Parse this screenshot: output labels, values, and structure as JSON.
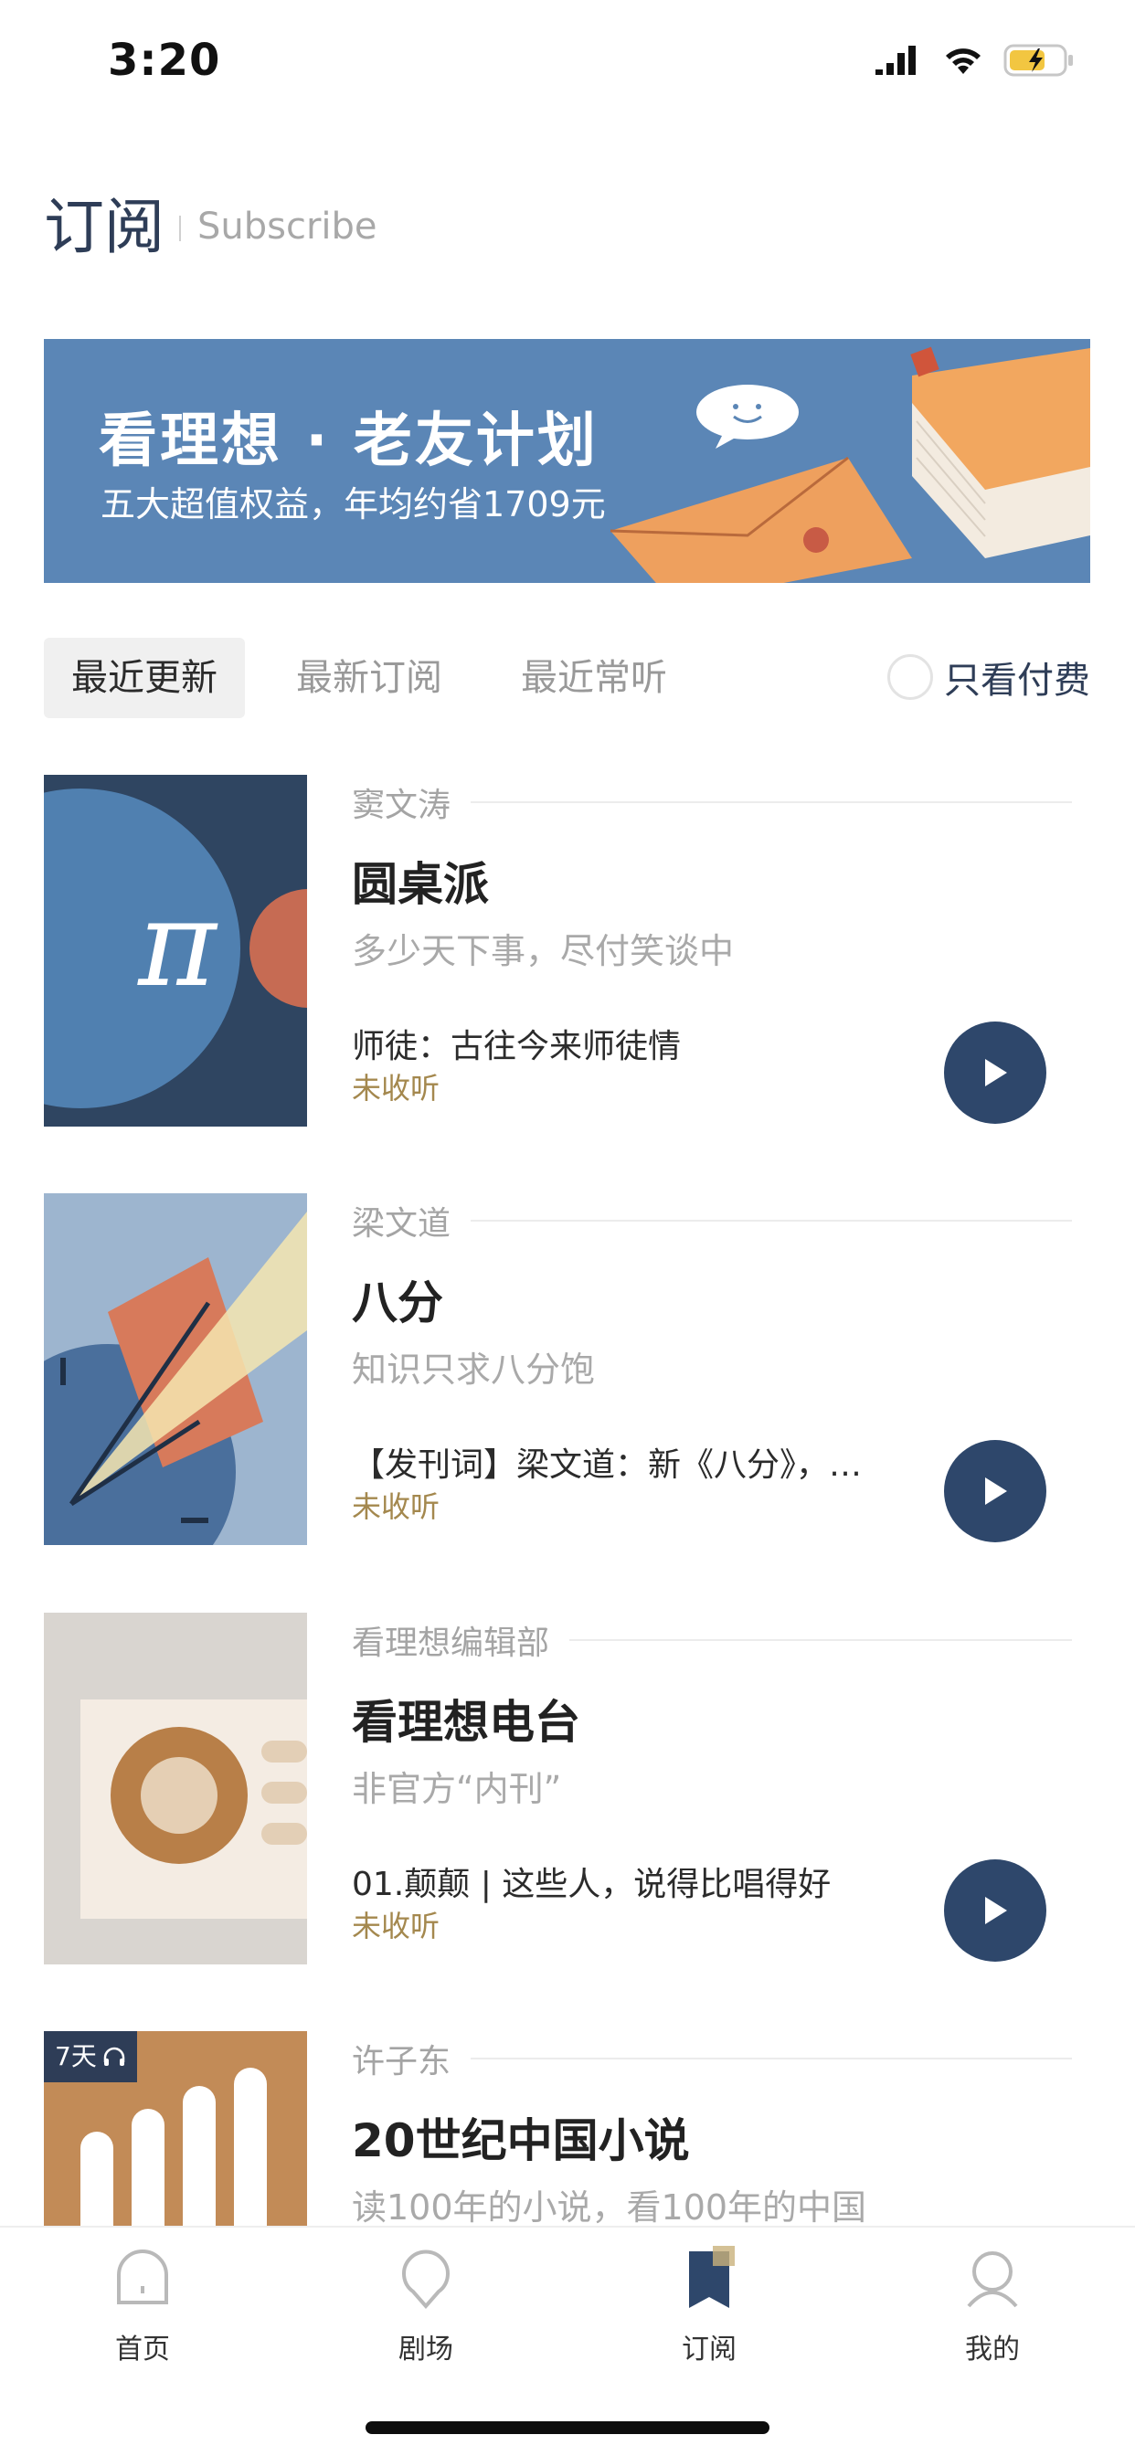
{
  "status_bar": {
    "time": "3:20"
  },
  "header": {
    "title": "订阅",
    "subtitle": "Subscribe"
  },
  "banner": {
    "title": "看理想 · 老友计划",
    "subtitle": "五大超值权益，年均约省1709元"
  },
  "filters": {
    "tabs": [
      "最近更新",
      "最新订阅",
      "最近常听"
    ],
    "active_tab": "最近更新",
    "paid_only_label": "只看付费"
  },
  "items": [
    {
      "author": "窦文涛",
      "title": "圆桌派",
      "desc": "多少天下事，尽付笑谈中",
      "episode": "师徒：古往今来师徒情",
      "status": "未收听",
      "cover_glyph": "π"
    },
    {
      "author": "梁文道",
      "title": "八分",
      "desc": "知识只求八分饱",
      "episode": "【发刊词】梁文道：新《八分》，…",
      "status": "未收听"
    },
    {
      "author": "看理想编辑部",
      "title": "看理想电台",
      "desc": "非官方“内刊”",
      "episode": "01.颠颠 | 这些人，说得比唱得好",
      "status": "未收听"
    },
    {
      "author": "许子东",
      "title": "20世纪中国小说",
      "desc": "读100年的小说，看100年的中国",
      "badge": "7天"
    }
  ],
  "tabbar": {
    "items": [
      {
        "label": "首页",
        "icon": "home-icon"
      },
      {
        "label": "剧场",
        "icon": "theater-icon"
      },
      {
        "label": "订阅",
        "icon": "bookmark-icon",
        "active": true
      },
      {
        "label": "我的",
        "icon": "profile-icon"
      }
    ]
  },
  "colors": {
    "accent": "#2e476b",
    "banner": "#5b86b6",
    "status_gold": "#a4884e"
  }
}
